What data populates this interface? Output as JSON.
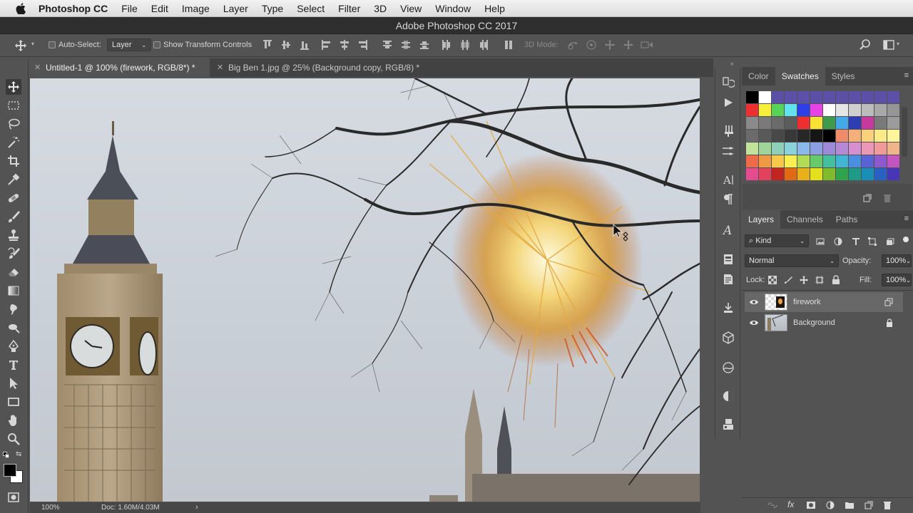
{
  "menubar": {
    "app": "Photoshop CC",
    "items": [
      "File",
      "Edit",
      "Image",
      "Layer",
      "Type",
      "Select",
      "Filter",
      "3D",
      "View",
      "Window",
      "Help"
    ]
  },
  "window": {
    "title": "Adobe Photoshop CC 2017"
  },
  "options": {
    "auto_select_label": "Auto-Select:",
    "auto_select_value": "Layer",
    "show_transform_label": "Show Transform Controls",
    "mode_3d_label": "3D Mode:"
  },
  "tabs": [
    {
      "label": "Untitled-1 @ 100% (firework, RGB/8*) *",
      "active": true
    },
    {
      "label": "Big Ben 1.jpg @ 25% (Background copy, RGB/8) *",
      "active": false
    }
  ],
  "status": {
    "zoom": "100%",
    "doc": "Doc: 1.60M/4.03M"
  },
  "swatch_panel": {
    "tabs": [
      "Color",
      "Swatches",
      "Styles"
    ],
    "active_tab": "Swatches"
  },
  "layers_panel": {
    "tabs": [
      "Layers",
      "Channels",
      "Paths"
    ],
    "active_tab": "Layers",
    "filter_label": "Kind",
    "blend_mode": "Normal",
    "opacity_label": "Opacity:",
    "opacity_value": "100%",
    "lock_label": "Lock:",
    "fill_label": "Fill:",
    "fill_value": "100%",
    "layers": [
      {
        "name": "firework",
        "selected": true
      },
      {
        "name": "Background",
        "selected": false
      }
    ]
  },
  "colors": {
    "swatches": [
      [
        "#000000",
        "#ffffff",
        "#5b4fa8",
        "#5b4fa8",
        "#5b4fa8",
        "#5b4fa8",
        "#5b4fa8",
        "#5b4fa8",
        "#5b4fa8",
        "#5b4fa8",
        "#5b4fa8",
        "#5b4fa8"
      ],
      [
        "#ee2f2f",
        "#f7ef3a",
        "#58d35a",
        "#63e3ec",
        "#2d3fe6",
        "#e642e6",
        "#ffffff",
        "#e6e6e6",
        "#cfcfcf",
        "#bcbcbc",
        "#a9a9a9",
        "#969696"
      ],
      [
        "#8a8a8a",
        "#7a7a7a",
        "#6a6a6a",
        "#5c5c5c",
        "#ee2f2f",
        "#f7e135",
        "#3e9b4c",
        "#45a9e8",
        "#2f3db2",
        "#c63a9e",
        "#7a7a7a",
        "#9c9c9c"
      ],
      [
        "#6b6b6b",
        "#595959",
        "#484848",
        "#383838",
        "#272727",
        "#151515",
        "#000000",
        "#f08b6a",
        "#f5b07a",
        "#f9d07b",
        "#fbeb88",
        "#fff49a"
      ],
      [
        "#c4e39a",
        "#9fd49a",
        "#8fd1b8",
        "#8bd3dc",
        "#8ab8e8",
        "#8c9fe1",
        "#9a8ad8",
        "#b48ad6",
        "#d690d0",
        "#ec97b5",
        "#f19a9a",
        "#f0b48a"
      ],
      [
        "#ee6b4a",
        "#f19a45",
        "#f7c84a",
        "#f8f04f",
        "#b1dc55",
        "#67c96a",
        "#44c0a0",
        "#41b6d4",
        "#4a8ee0",
        "#5a63d6",
        "#8e58cf",
        "#c255c2"
      ],
      [
        "#e54b8f",
        "#e2425d",
        "#c2241f",
        "#e26a13",
        "#e8b01b",
        "#e3e01d",
        "#7fbc2c",
        "#2fa44c",
        "#1f9a86",
        "#198fb6",
        "#2860c3",
        "#4737b6"
      ]
    ]
  }
}
